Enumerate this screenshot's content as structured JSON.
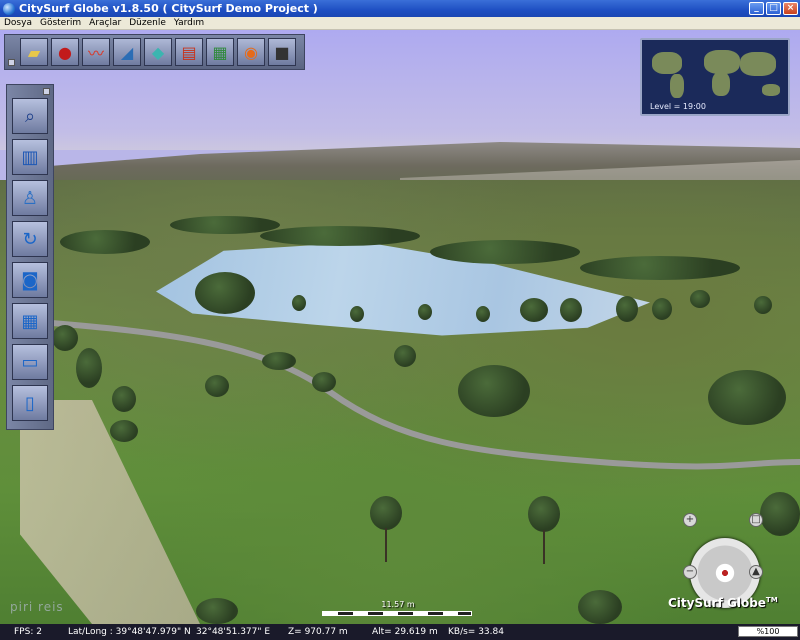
{
  "window": {
    "title": "CitySurf Globe v1.8.50    ( CitySurf Demo Project )"
  },
  "menu": [
    "Dosya",
    "Gösterim",
    "Araçlar",
    "Düzenle",
    "Yardım"
  ],
  "minimap": {
    "level_text": "Level = 19:00"
  },
  "scale": {
    "label": "11.57 m"
  },
  "brand": {
    "text": "CitySurf Globe",
    "tm": "TM"
  },
  "watermark": {
    "text": "piri reis"
  },
  "status": {
    "fps": "FPS: 2",
    "latlong": "Lat/Long : 39°48'47.979\" N",
    "lon": "32°48'51.377\" E",
    "z": "Z= 970.77 m",
    "alt": "Alt= 29.619 m",
    "kbs": "KB/s= 33.84",
    "progress": "%100"
  },
  "toolbar_icons": [
    "folder-icon",
    "pushpin-icon",
    "chart-line-icon",
    "layer-pen-icon",
    "diamond-layer-icon",
    "book-icon",
    "grid-icon",
    "rss-icon",
    "camera-icon"
  ],
  "left_icons": [
    "magnifier-icon",
    "building-icon",
    "person-icon",
    "rotate-icon",
    "photo-camera-icon",
    "calculator-icon",
    "printer-icon",
    "clipboard-icon"
  ],
  "colors": {
    "sky": "#b3aeee",
    "titlebar": "#2a5cd0",
    "statusbar": "#1a1a2a"
  }
}
